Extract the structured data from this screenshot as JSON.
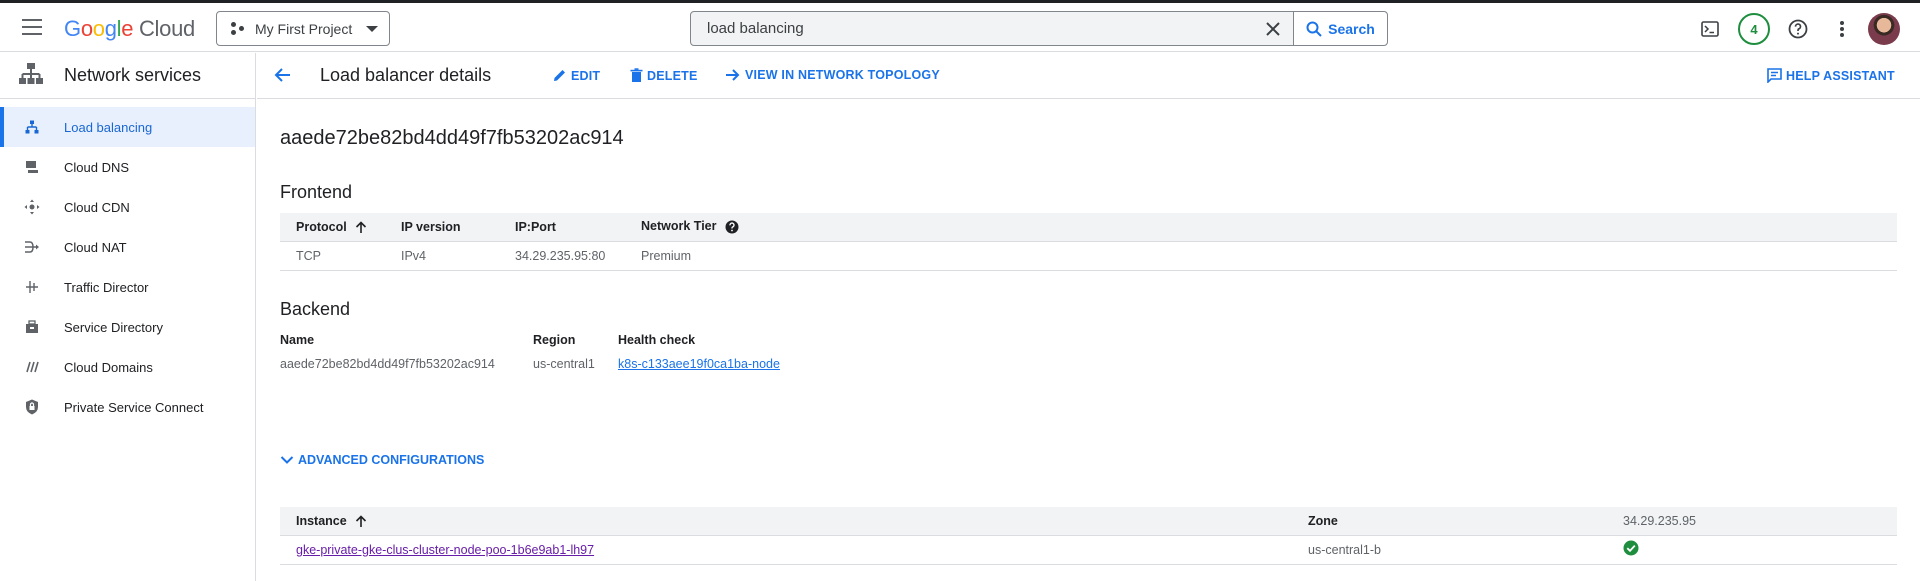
{
  "topbar": {
    "logo": {
      "g": "G",
      "o1": "o",
      "o2": "o",
      "g2": "g",
      "l": "l",
      "e": "e",
      "cloud": "Cloud"
    },
    "project": "My First Project",
    "search": {
      "value": "load balancing",
      "placeholder": "Search",
      "button": "Search"
    },
    "notifications_count": "4",
    "icons": [
      "menu-icon",
      "terminal-icon",
      "help-icon",
      "more-vert-icon",
      "avatar"
    ]
  },
  "sidebar": {
    "title": "Network services",
    "items": [
      {
        "label": "Load balancing",
        "icon": "load-balancing-icon",
        "active": true
      },
      {
        "label": "Cloud DNS",
        "icon": "dns-icon",
        "active": false
      },
      {
        "label": "Cloud CDN",
        "icon": "cdn-icon",
        "active": false
      },
      {
        "label": "Cloud NAT",
        "icon": "nat-icon",
        "active": false
      },
      {
        "label": "Traffic Director",
        "icon": "traffic-director-icon",
        "active": false
      },
      {
        "label": "Service Directory",
        "icon": "service-directory-icon",
        "active": false
      },
      {
        "label": "Cloud Domains",
        "icon": "domains-icon",
        "active": false
      },
      {
        "label": "Private Service Connect",
        "icon": "private-service-connect-icon",
        "active": false
      }
    ]
  },
  "page": {
    "title": "Load balancer details",
    "actions": {
      "edit": "EDIT",
      "delete": "DELETE",
      "topology": "VIEW IN NETWORK TOPOLOGY",
      "help": "HELP ASSISTANT"
    },
    "lb_name": "aaede72be82bd4dd49f7fb53202ac914"
  },
  "frontend": {
    "title": "Frontend",
    "columns": [
      "Protocol",
      "IP version",
      "IP:Port",
      "Network Tier"
    ],
    "rows": [
      [
        "TCP",
        "IPv4",
        "34.29.235.95:80",
        "Premium"
      ]
    ]
  },
  "backend": {
    "title": "Backend",
    "labels": {
      "name": "Name",
      "region": "Region",
      "health": "Health check"
    },
    "values": {
      "name": "aaede72be82bd4dd49f7fb53202ac914",
      "region": "us-central1",
      "health": "k8s-c133aee19f0ca1ba-node"
    },
    "advanced": "ADVANCED CONFIGURATIONS"
  },
  "instances": {
    "columns": [
      "Instance",
      "Zone",
      "34.29.235.95"
    ],
    "rows": [
      {
        "instance": "gke-private-gke-clus-cluster-node-poo-1b6e9ab1-lh97",
        "zone": "us-central1-b",
        "status": "healthy"
      }
    ]
  },
  "colors": {
    "accent": "#1a73e8",
    "healthy": "#1e8e3e",
    "visited_link": "#681da8"
  }
}
